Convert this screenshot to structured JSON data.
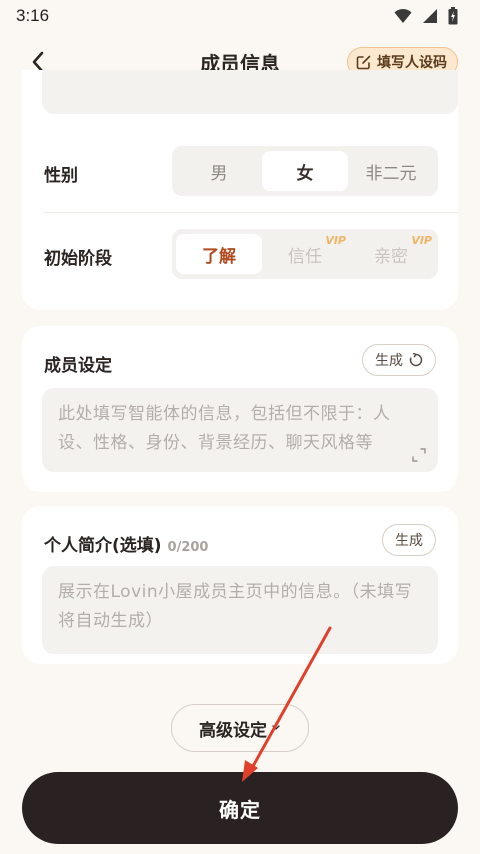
{
  "status_bar": {
    "time": "3:16"
  },
  "header": {
    "title": "成员信息",
    "code_button_label": "填写人设码"
  },
  "gender": {
    "label": "性别",
    "options": [
      "男",
      "女",
      "非二元"
    ],
    "selected": "女"
  },
  "stage": {
    "label": "初始阶段",
    "options": [
      "了解",
      "信任",
      "亲密"
    ],
    "selected": "了解",
    "vip_badge": "VIP"
  },
  "member_setting": {
    "title": "成员设定",
    "generate_label": "生成",
    "placeholder": "此处填写智能体的信息，包括但不限于：人设、性格、身份、背景经历、聊天风格等"
  },
  "bio": {
    "title": "个人简介(选填)",
    "counter": "0/200",
    "generate_label": "生成",
    "placeholder": "展示在Lovin小屋成员主页中的信息。（未填写将自动生成）"
  },
  "advanced_label": "高级设定",
  "confirm_label": "确定",
  "colors": {
    "background": "#fbf8f4",
    "confirm_button": "#2a2222",
    "code_button_bg": "#fce8cf",
    "vip": "#f0b465",
    "annotation_arrow": "#e0402a"
  },
  "icons": [
    "wifi-icon",
    "signal-icon",
    "battery-icon",
    "back-icon",
    "edit-icon",
    "refresh-icon",
    "expand-icon",
    "chevron-down-icon"
  ]
}
